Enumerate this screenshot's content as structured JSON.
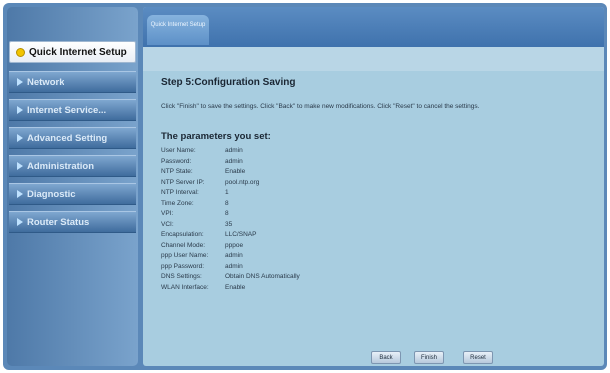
{
  "sidebar": {
    "items": [
      {
        "label": "Quick Internet Setup",
        "active": true
      },
      {
        "label": "Network"
      },
      {
        "label": "Internet Service..."
      },
      {
        "label": "Advanced Setting"
      },
      {
        "label": "Administration"
      },
      {
        "label": "Diagnostic"
      },
      {
        "label": "Router Status"
      }
    ]
  },
  "tab": {
    "label": "Quick Internet Setup"
  },
  "main": {
    "step_title": "Step 5:Configuration Saving",
    "description": "Click \"Finish\" to save the settings. Click \"Back\" to make new modifications. Click \"Reset\" to cancel the settings.",
    "params_title": "The parameters you set:",
    "params": [
      {
        "key": "User Name:",
        "value": "admin"
      },
      {
        "key": "Password:",
        "value": "admin"
      },
      {
        "key": "NTP State:",
        "value": "Enable"
      },
      {
        "key": "NTP Server IP:",
        "value": "pool.ntp.org"
      },
      {
        "key": "NTP Interval:",
        "value": "1"
      },
      {
        "key": "Time Zone:",
        "value": "8"
      },
      {
        "key": "VPI:",
        "value": "8"
      },
      {
        "key": "VCI:",
        "value": "35"
      },
      {
        "key": "Encapsulation:",
        "value": "LLC/SNAP"
      },
      {
        "key": "Channel Mode:",
        "value": "pppoe"
      },
      {
        "key": "ppp User Name:",
        "value": "admin"
      },
      {
        "key": "ppp Password:",
        "value": "admin"
      },
      {
        "key": "DNS Settings:",
        "value": "Obtain DNS Automatically"
      },
      {
        "key": "WLAN Interface:",
        "value": "Enable"
      }
    ]
  },
  "buttons": {
    "back": "Back",
    "finish": "Finish",
    "reset": "Reset"
  }
}
